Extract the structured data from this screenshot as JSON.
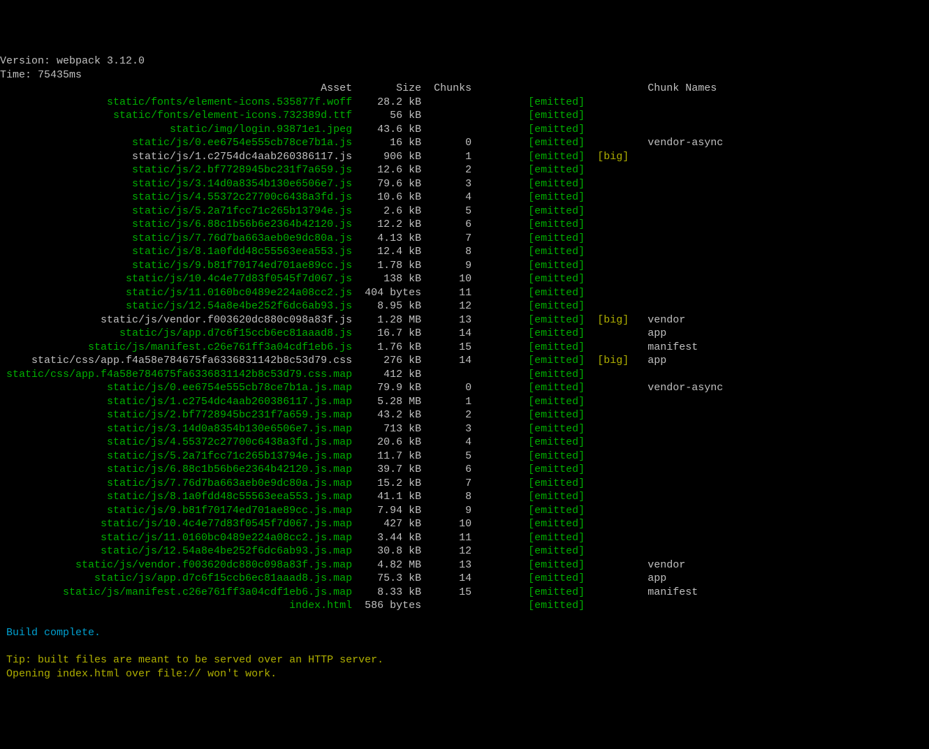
{
  "version_label": "Version: ",
  "version_name": "webpack ",
  "version_value": "3.12.0",
  "time_label": "Time: ",
  "time_value_number": "75435",
  "time_value_unit": "ms",
  "col_asset": "Asset",
  "col_size": "Size",
  "col_chunks": "Chunks",
  "col_chunk_names": "Chunk Names",
  "emitted_text": "[emitted]",
  "big_text": "[big]",
  "rows": [
    {
      "asset": "static/fonts/element-icons.535877f.woff",
      "size": "28.2 kB",
      "chunks": "",
      "big": "",
      "name": "",
      "asset_color": "green"
    },
    {
      "asset": "static/fonts/element-icons.732389d.ttf",
      "size": "56 kB",
      "chunks": "",
      "big": "",
      "name": "",
      "asset_color": "green"
    },
    {
      "asset": "static/img/login.93871e1.jpeg",
      "size": "43.6 kB",
      "chunks": "",
      "big": "",
      "name": "",
      "asset_color": "green"
    },
    {
      "asset": "static/js/0.ee6754e555cb78ce7b1a.js",
      "size": "16 kB",
      "chunks": "0",
      "big": "",
      "name": "vendor-async",
      "asset_color": "green"
    },
    {
      "asset": "static/js/1.c2754dc4aab260386117.js",
      "size": "906 kB",
      "chunks": "1",
      "big": "[big]",
      "name": "",
      "asset_color": "white"
    },
    {
      "asset": "static/js/2.bf7728945bc231f7a659.js",
      "size": "12.6 kB",
      "chunks": "2",
      "big": "",
      "name": "",
      "asset_color": "green"
    },
    {
      "asset": "static/js/3.14d0a8354b130e6506e7.js",
      "size": "79.6 kB",
      "chunks": "3",
      "big": "",
      "name": "",
      "asset_color": "green"
    },
    {
      "asset": "static/js/4.55372c27700c6438a3fd.js",
      "size": "10.6 kB",
      "chunks": "4",
      "big": "",
      "name": "",
      "asset_color": "green"
    },
    {
      "asset": "static/js/5.2a71fcc71c265b13794e.js",
      "size": "2.6 kB",
      "chunks": "5",
      "big": "",
      "name": "",
      "asset_color": "green"
    },
    {
      "asset": "static/js/6.88c1b56b6e2364b42120.js",
      "size": "12.2 kB",
      "chunks": "6",
      "big": "",
      "name": "",
      "asset_color": "green"
    },
    {
      "asset": "static/js/7.76d7ba663aeb0e9dc80a.js",
      "size": "4.13 kB",
      "chunks": "7",
      "big": "",
      "name": "",
      "asset_color": "green"
    },
    {
      "asset": "static/js/8.1a0fdd48c55563eea553.js",
      "size": "12.4 kB",
      "chunks": "8",
      "big": "",
      "name": "",
      "asset_color": "green"
    },
    {
      "asset": "static/js/9.b81f70174ed701ae89cc.js",
      "size": "1.78 kB",
      "chunks": "9",
      "big": "",
      "name": "",
      "asset_color": "green"
    },
    {
      "asset": "static/js/10.4c4e77d83f0545f7d067.js",
      "size": "138 kB",
      "chunks": "10",
      "big": "",
      "name": "",
      "asset_color": "green"
    },
    {
      "asset": "static/js/11.0160bc0489e224a08cc2.js",
      "size": "404 bytes",
      "chunks": "11",
      "big": "",
      "name": "",
      "asset_color": "green"
    },
    {
      "asset": "static/js/12.54a8e4be252f6dc6ab93.js",
      "size": "8.95 kB",
      "chunks": "12",
      "big": "",
      "name": "",
      "asset_color": "green"
    },
    {
      "asset": "static/js/vendor.f003620dc880c098a83f.js",
      "size": "1.28 MB",
      "chunks": "13",
      "big": "[big]",
      "name": "vendor",
      "asset_color": "white"
    },
    {
      "asset": "static/js/app.d7c6f15ccb6ec81aaad8.js",
      "size": "16.7 kB",
      "chunks": "14",
      "big": "",
      "name": "app",
      "asset_color": "green"
    },
    {
      "asset": "static/js/manifest.c26e761ff3a04cdf1eb6.js",
      "size": "1.76 kB",
      "chunks": "15",
      "big": "",
      "name": "manifest",
      "asset_color": "green"
    },
    {
      "asset": "static/css/app.f4a58e784675fa6336831142b8c53d79.css",
      "size": "276 kB",
      "chunks": "14",
      "big": "[big]",
      "name": "app",
      "asset_color": "white"
    },
    {
      "asset": "static/css/app.f4a58e784675fa6336831142b8c53d79.css.map",
      "size": "412 kB",
      "chunks": "",
      "big": "",
      "name": "",
      "asset_color": "green"
    },
    {
      "asset": "static/js/0.ee6754e555cb78ce7b1a.js.map",
      "size": "79.9 kB",
      "chunks": "0",
      "big": "",
      "name": "vendor-async",
      "asset_color": "green"
    },
    {
      "asset": "static/js/1.c2754dc4aab260386117.js.map",
      "size": "5.28 MB",
      "chunks": "1",
      "big": "",
      "name": "",
      "asset_color": "green"
    },
    {
      "asset": "static/js/2.bf7728945bc231f7a659.js.map",
      "size": "43.2 kB",
      "chunks": "2",
      "big": "",
      "name": "",
      "asset_color": "green"
    },
    {
      "asset": "static/js/3.14d0a8354b130e6506e7.js.map",
      "size": "713 kB",
      "chunks": "3",
      "big": "",
      "name": "",
      "asset_color": "green"
    },
    {
      "asset": "static/js/4.55372c27700c6438a3fd.js.map",
      "size": "20.6 kB",
      "chunks": "4",
      "big": "",
      "name": "",
      "asset_color": "green"
    },
    {
      "asset": "static/js/5.2a71fcc71c265b13794e.js.map",
      "size": "11.7 kB",
      "chunks": "5",
      "big": "",
      "name": "",
      "asset_color": "green"
    },
    {
      "asset": "static/js/6.88c1b56b6e2364b42120.js.map",
      "size": "39.7 kB",
      "chunks": "6",
      "big": "",
      "name": "",
      "asset_color": "green"
    },
    {
      "asset": "static/js/7.76d7ba663aeb0e9dc80a.js.map",
      "size": "15.2 kB",
      "chunks": "7",
      "big": "",
      "name": "",
      "asset_color": "green"
    },
    {
      "asset": "static/js/8.1a0fdd48c55563eea553.js.map",
      "size": "41.1 kB",
      "chunks": "8",
      "big": "",
      "name": "",
      "asset_color": "green"
    },
    {
      "asset": "static/js/9.b81f70174ed701ae89cc.js.map",
      "size": "7.94 kB",
      "chunks": "9",
      "big": "",
      "name": "",
      "asset_color": "green"
    },
    {
      "asset": "static/js/10.4c4e77d83f0545f7d067.js.map",
      "size": "427 kB",
      "chunks": "10",
      "big": "",
      "name": "",
      "asset_color": "green"
    },
    {
      "asset": "static/js/11.0160bc0489e224a08cc2.js.map",
      "size": "3.44 kB",
      "chunks": "11",
      "big": "",
      "name": "",
      "asset_color": "green"
    },
    {
      "asset": "static/js/12.54a8e4be252f6dc6ab93.js.map",
      "size": "30.8 kB",
      "chunks": "12",
      "big": "",
      "name": "",
      "asset_color": "green"
    },
    {
      "asset": "static/js/vendor.f003620dc880c098a83f.js.map",
      "size": "4.82 MB",
      "chunks": "13",
      "big": "",
      "name": "vendor",
      "asset_color": "green"
    },
    {
      "asset": "static/js/app.d7c6f15ccb6ec81aaad8.js.map",
      "size": "75.3 kB",
      "chunks": "14",
      "big": "",
      "name": "app",
      "asset_color": "green"
    },
    {
      "asset": "static/js/manifest.c26e761ff3a04cdf1eb6.js.map",
      "size": "8.33 kB",
      "chunks": "15",
      "big": "",
      "name": "manifest",
      "asset_color": "green"
    },
    {
      "asset": "index.html",
      "size": "586 bytes",
      "chunks": "",
      "big": "",
      "name": "",
      "asset_color": "green"
    }
  ],
  "build_complete": "Build complete.",
  "tip1": "Tip: built files are meant to be served over an HTTP server.",
  "tip2": "Opening index.html over file:// won't work.",
  "columns": {
    "asset_w": 56,
    "size_w": 11,
    "chunks_w": 8,
    "flags_w": 18,
    "big_w": 8
  }
}
